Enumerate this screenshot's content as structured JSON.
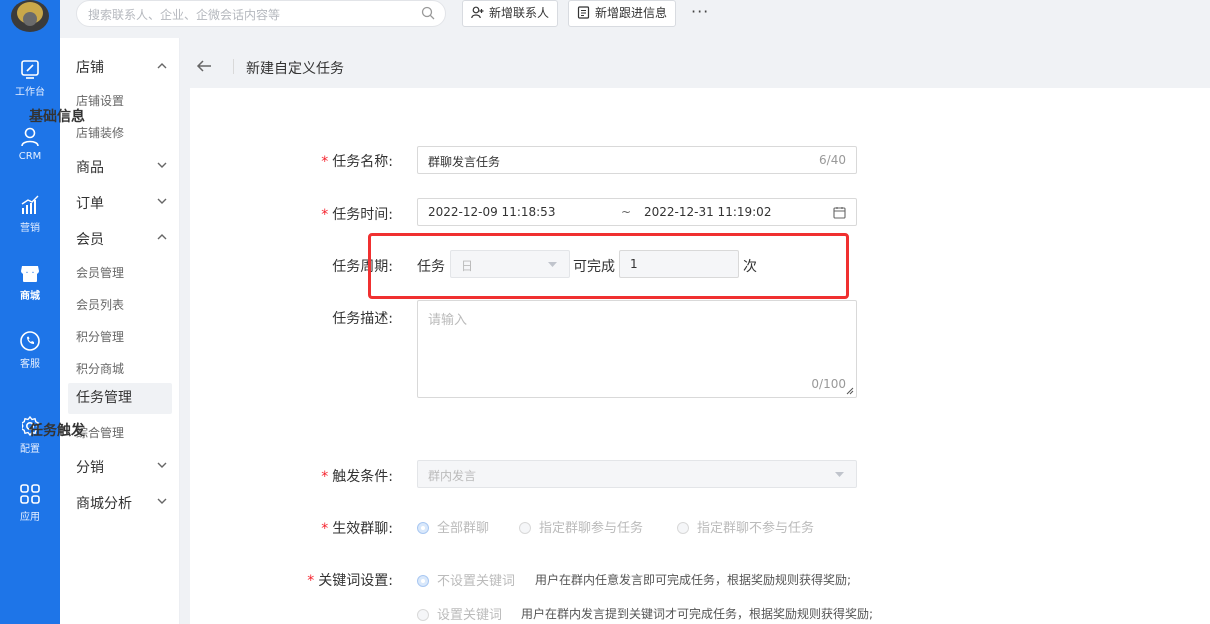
{
  "nav": {
    "items": [
      {
        "label": "工作台"
      },
      {
        "label": "CRM"
      },
      {
        "label": "营销"
      },
      {
        "label": "商城"
      },
      {
        "label": "客服"
      },
      {
        "label": "配置"
      },
      {
        "label": "应用"
      }
    ],
    "active": "商城"
  },
  "topbar": {
    "search_placeholder": "搜索联系人、企业、企微会话内容等",
    "add_contact_label": "新增联系人",
    "add_followup_label": "新增跟进信息",
    "more_label": "···"
  },
  "sidebar": {
    "groups": [
      {
        "label": "店铺",
        "expanded": true,
        "items": [
          "店铺设置",
          "店铺装修"
        ]
      },
      {
        "label": "商品",
        "expanded": false
      },
      {
        "label": "订单",
        "expanded": false
      },
      {
        "label": "会员",
        "expanded": true,
        "items": [
          "会员管理",
          "会员列表",
          "积分管理",
          "积分商城",
          "任务管理",
          "综合管理"
        ]
      },
      {
        "label": "分销",
        "expanded": false
      },
      {
        "label": "商城分析",
        "expanded": false
      }
    ],
    "active_item": "任务管理"
  },
  "page": {
    "title": "新建自定义任务",
    "section_basic": "基础信息",
    "section_trigger": "任务触发",
    "task_name": {
      "label": "任务名称:",
      "value": "群聊发言任务",
      "counter": "6/40"
    },
    "task_time": {
      "label": "任务时间:",
      "start": "2022-12-09 11:18:53",
      "separator": "~",
      "end": "2022-12-31 11:19:02"
    },
    "task_cycle": {
      "label": "任务周期:",
      "prefix": "任务",
      "period": "日",
      "middle": "可完成",
      "count": "1",
      "suffix": "次"
    },
    "task_desc": {
      "label": "任务描述:",
      "placeholder": "请输入",
      "counter": "0/100"
    },
    "trigger_condition": {
      "label": "触发条件:",
      "value": "群内发言"
    },
    "effective_group": {
      "label": "生效群聊:",
      "options": [
        "全部群聊",
        "指定群聊参与任务",
        "指定群聊不参与任务"
      ],
      "selected": "全部群聊"
    },
    "keyword": {
      "label": "关键词设置:",
      "options": [
        {
          "label": "不设置关键词",
          "hint": "用户在群内任意发言即可完成任务，根据奖励规则获得奖励;"
        },
        {
          "label": "设置关键词",
          "hint": "用户在群内发言提到关键词才可完成任务，根据奖励规则获得奖励;"
        }
      ],
      "selected": "不设置关键词"
    }
  }
}
